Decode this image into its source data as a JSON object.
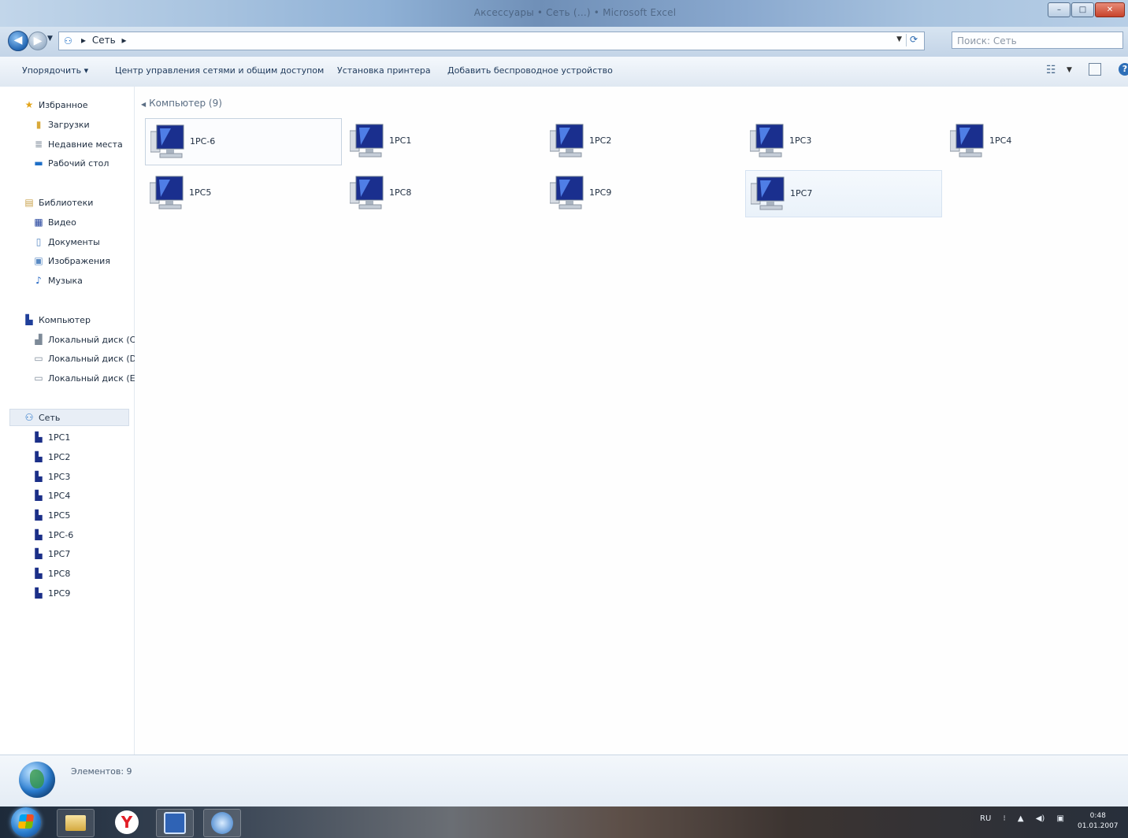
{
  "window": {
    "title": "Аксессуары • Сеть (…) • Microsoft Excel"
  },
  "addressbar": {
    "breadcrumb": [
      "Сеть",
      "▸"
    ],
    "search_placeholder": "Поиск: Сеть"
  },
  "commandbar": {
    "organize": "Упорядочить ▾",
    "network_center": "Центр управления сетями и общим доступом",
    "install_printer": "Установка принтера",
    "add_wireless": "Добавить беспроводное устройство"
  },
  "nav": {
    "favorites": "Избранное",
    "downloads": "Загрузки",
    "recent": "Недавние места",
    "desktop": "Рабочий стол",
    "libraries": "Библиотеки",
    "video": "Видео",
    "documents": "Документы",
    "images": "Изображения",
    "music": "Музыка",
    "computer": "Компьютер",
    "disk_c": "Локальный диск (C",
    "disk_d": "Локальный диск (D",
    "disk_e": "Локальный диск (E",
    "network": "Сеть",
    "network_pcs": [
      "1PC1",
      "1PC2",
      "1PC3",
      "1PC4",
      "1PC5",
      "1PC-6",
      "1PC7",
      "1PC8",
      "1PC9"
    ]
  },
  "content": {
    "group_header": "Компьютер (9)",
    "tiles": [
      "1PC-6",
      "1PC1",
      "1PC2",
      "1PC3",
      "1PC4",
      "1PC5",
      "1PC8",
      "1PC9",
      "1PC7"
    ]
  },
  "details": {
    "text": "Элементов: 9"
  },
  "taskbar": {
    "tray": [
      "RU",
      "⁝",
      "▲",
      "◀)",
      "▣"
    ],
    "time": "0:48",
    "date": "01.01.2007"
  }
}
